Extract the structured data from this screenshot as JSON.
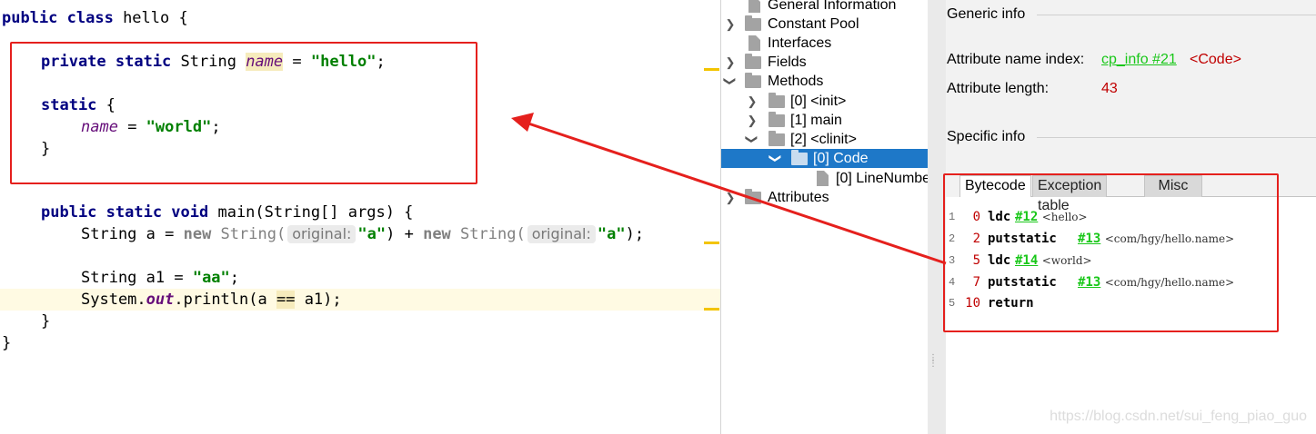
{
  "editor": {
    "line1": {
      "kw": "public class",
      "rest": " hello {"
    },
    "line2": {
      "kw": "private static",
      "type": " String ",
      "field": "name",
      "eq": " = ",
      "str": "\"hello\"",
      "end": ";"
    },
    "line3": {
      "kw": "static",
      "rest": " {"
    },
    "line4": {
      "field": "name",
      "eq": " = ",
      "str": "\"world\"",
      "end": ";"
    },
    "line5": {
      "text": "}"
    },
    "line6": {
      "kw": "public static void",
      "rest": " main(String[] args) {"
    },
    "line7": {
      "pre": "String a = ",
      "new1": "new",
      "type1": " String(",
      "hint1": "original:",
      "str1": "\"a\"",
      "mid": ") + ",
      "new2": "new",
      "type2": " String(",
      "hint2": "original:",
      "str2": "\"a\"",
      "end": ");"
    },
    "line8": {
      "pre": "String a1 = ",
      "str": "\"aa\"",
      "end": ";"
    },
    "line9": {
      "pre": "System.",
      "out": "out",
      "mid": ".println(a ",
      "op": "==",
      "end": " a1);"
    },
    "line10": {
      "text": "}"
    },
    "line11": {
      "text": "}"
    }
  },
  "tree": {
    "items": [
      {
        "label": "General Information"
      },
      {
        "label": "Constant Pool"
      },
      {
        "label": "Interfaces"
      },
      {
        "label": "Fields"
      },
      {
        "label": "Methods"
      },
      {
        "label": "[0] <init>"
      },
      {
        "label": "[1] main"
      },
      {
        "label": "[2] <clinit>"
      },
      {
        "label": "[0] Code"
      },
      {
        "label": "[0] LineNumbe"
      },
      {
        "label": "Attributes"
      }
    ]
  },
  "detail": {
    "generic_title": "Generic info",
    "attr_name_label": "Attribute name index:",
    "attr_name_link": "cp_info #21",
    "attr_name_value": "<Code>",
    "attr_length_label": "Attribute length:",
    "attr_length_value": "43",
    "specific_title": "Specific info",
    "tabs": [
      "Bytecode",
      "Exception table",
      "Misc"
    ],
    "bytecode": [
      {
        "line": "1",
        "offset": "0",
        "op": "ldc",
        "ref": "#12",
        "comment": "<hello>"
      },
      {
        "line": "2",
        "offset": "2",
        "op": "putstatic",
        "ref": "#13",
        "comment": "<com/hgy/hello.name>"
      },
      {
        "line": "3",
        "offset": "5",
        "op": "ldc",
        "ref": "#14",
        "comment": "<world>"
      },
      {
        "line": "4",
        "offset": "7",
        "op": "putstatic",
        "ref": "#13",
        "comment": "<com/hgy/hello.name>"
      },
      {
        "line": "5",
        "offset": "10",
        "op": "return",
        "ref": "",
        "comment": ""
      }
    ]
  },
  "watermark": "https://blog.csdn.net/sui_feng_piao_guo",
  "colors": {
    "annotation_red": "#e5201d",
    "selection_blue": "#1e78c8",
    "link_green": "#19c719",
    "value_red": "#c00000",
    "keyword_navy": "#000080",
    "string_green": "#008000",
    "field_purple": "#660e7a"
  }
}
